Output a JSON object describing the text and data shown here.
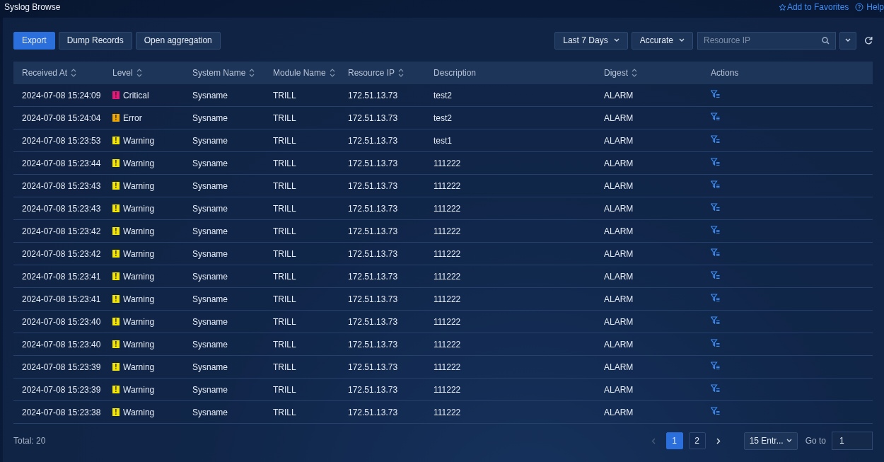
{
  "header": {
    "title": "Syslog Browse",
    "links": [
      {
        "kind": "favorite",
        "label": "Add to Favorites"
      },
      {
        "kind": "help",
        "label": "Help"
      }
    ]
  },
  "toolbar": {
    "buttons": [
      {
        "label": "Export",
        "primary": true
      },
      {
        "label": "Dump Records",
        "primary": false
      },
      {
        "label": "Open aggregation",
        "primary": false
      }
    ],
    "time_range": "Last 7 Days",
    "match_mode": "Accurate",
    "search": {
      "placeholder": "Resource IP"
    }
  },
  "table": {
    "columns": [
      {
        "label": "Received At",
        "sortable": true
      },
      {
        "label": "Level",
        "sortable": true
      },
      {
        "label": "System Name",
        "sortable": true
      },
      {
        "label": "Module Name",
        "sortable": true
      },
      {
        "label": "Resource IP",
        "sortable": true
      },
      {
        "label": "Description",
        "sortable": false
      },
      {
        "label": "Digest",
        "sortable": true
      },
      {
        "label": "Actions",
        "sortable": false
      }
    ],
    "rows": [
      {
        "received_at": "2024-07-08 15:24:09",
        "level": {
          "mark": "!",
          "label": "Critical",
          "color": "#e8177a"
        },
        "system_name": "Sysname",
        "module_name": "TRILL",
        "resource_ip": "172.51.13.73",
        "description": "test2",
        "digest": "ALARM"
      },
      {
        "received_at": "2024-07-08 15:24:04",
        "level": {
          "mark": "!",
          "label": "Error",
          "color": "#f0a800"
        },
        "system_name": "Sysname",
        "module_name": "TRILL",
        "resource_ip": "172.51.13.73",
        "description": "test2",
        "digest": "ALARM"
      },
      {
        "received_at": "2024-07-08 15:23:53",
        "level": {
          "mark": "!",
          "label": "Warning",
          "color": "#f5e600"
        },
        "system_name": "Sysname",
        "module_name": "TRILL",
        "resource_ip": "172.51.13.73",
        "description": "test1",
        "digest": "ALARM"
      },
      {
        "received_at": "2024-07-08 15:23:44",
        "level": {
          "mark": "!",
          "label": "Warning",
          "color": "#f5e600"
        },
        "system_name": "Sysname",
        "module_name": "TRILL",
        "resource_ip": "172.51.13.73",
        "description": "111222",
        "digest": "ALARM"
      },
      {
        "received_at": "2024-07-08 15:23:43",
        "level": {
          "mark": "!",
          "label": "Warning",
          "color": "#f5e600"
        },
        "system_name": "Sysname",
        "module_name": "TRILL",
        "resource_ip": "172.51.13.73",
        "description": "111222",
        "digest": "ALARM"
      },
      {
        "received_at": "2024-07-08 15:23:43",
        "level": {
          "mark": "!",
          "label": "Warning",
          "color": "#f5e600"
        },
        "system_name": "Sysname",
        "module_name": "TRILL",
        "resource_ip": "172.51.13.73",
        "description": "111222",
        "digest": "ALARM"
      },
      {
        "received_at": "2024-07-08 15:23:42",
        "level": {
          "mark": "!",
          "label": "Warning",
          "color": "#f5e600"
        },
        "system_name": "Sysname",
        "module_name": "TRILL",
        "resource_ip": "172.51.13.73",
        "description": "111222",
        "digest": "ALARM"
      },
      {
        "received_at": "2024-07-08 15:23:42",
        "level": {
          "mark": "!",
          "label": "Warning",
          "color": "#f5e600"
        },
        "system_name": "Sysname",
        "module_name": "TRILL",
        "resource_ip": "172.51.13.73",
        "description": "111222",
        "digest": "ALARM"
      },
      {
        "received_at": "2024-07-08 15:23:41",
        "level": {
          "mark": "!",
          "label": "Warning",
          "color": "#f5e600"
        },
        "system_name": "Sysname",
        "module_name": "TRILL",
        "resource_ip": "172.51.13.73",
        "description": "111222",
        "digest": "ALARM"
      },
      {
        "received_at": "2024-07-08 15:23:41",
        "level": {
          "mark": "!",
          "label": "Warning",
          "color": "#f5e600"
        },
        "system_name": "Sysname",
        "module_name": "TRILL",
        "resource_ip": "172.51.13.73",
        "description": "111222",
        "digest": "ALARM"
      },
      {
        "received_at": "2024-07-08 15:23:40",
        "level": {
          "mark": "!",
          "label": "Warning",
          "color": "#f5e600"
        },
        "system_name": "Sysname",
        "module_name": "TRILL",
        "resource_ip": "172.51.13.73",
        "description": "111222",
        "digest": "ALARM"
      },
      {
        "received_at": "2024-07-08 15:23:40",
        "level": {
          "mark": "!",
          "label": "Warning",
          "color": "#f5e600"
        },
        "system_name": "Sysname",
        "module_name": "TRILL",
        "resource_ip": "172.51.13.73",
        "description": "111222",
        "digest": "ALARM"
      },
      {
        "received_at": "2024-07-08 15:23:39",
        "level": {
          "mark": "!",
          "label": "Warning",
          "color": "#f5e600"
        },
        "system_name": "Sysname",
        "module_name": "TRILL",
        "resource_ip": "172.51.13.73",
        "description": "111222",
        "digest": "ALARM"
      },
      {
        "received_at": "2024-07-08 15:23:39",
        "level": {
          "mark": "!",
          "label": "Warning",
          "color": "#f5e600"
        },
        "system_name": "Sysname",
        "module_name": "TRILL",
        "resource_ip": "172.51.13.73",
        "description": "111222",
        "digest": "ALARM"
      },
      {
        "received_at": "2024-07-08 15:23:38",
        "level": {
          "mark": "!",
          "label": "Warning",
          "color": "#f5e600"
        },
        "system_name": "Sysname",
        "module_name": "TRILL",
        "resource_ip": "172.51.13.73",
        "description": "111222",
        "digest": "ALARM"
      }
    ]
  },
  "footer": {
    "total": "Total: 20",
    "pagination": {
      "prev_disabled": true,
      "pages": [
        {
          "label": "1",
          "selected": true
        },
        {
          "label": "2",
          "selected": false
        }
      ],
      "page_size": "15 Entr...",
      "goto_label": "Go to",
      "goto_value": "1"
    }
  }
}
